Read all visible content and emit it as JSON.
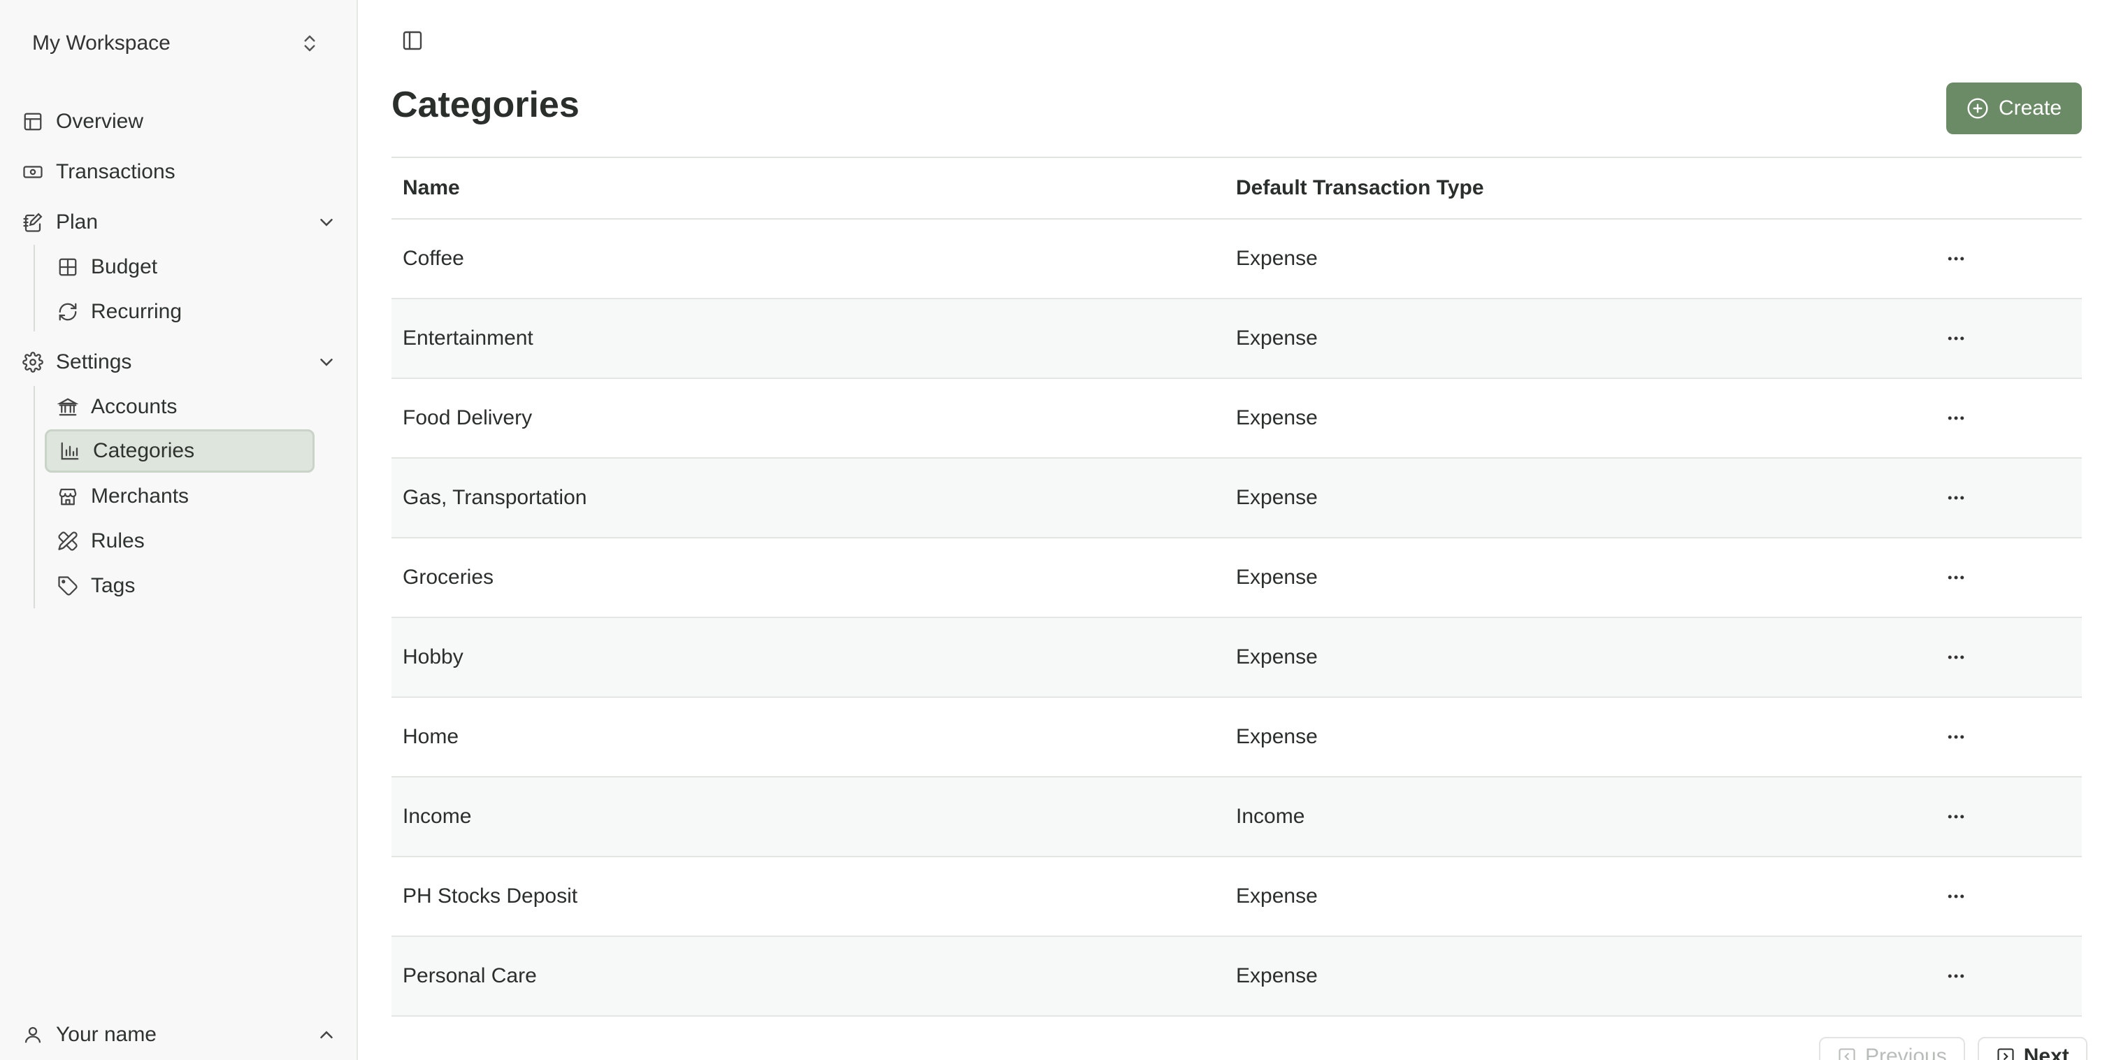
{
  "sidebar": {
    "workspace": "My Workspace",
    "items": [
      {
        "label": "Overview",
        "icon": "layout-icon"
      },
      {
        "label": "Transactions",
        "icon": "banknote-icon"
      },
      {
        "label": "Plan",
        "icon": "notebook-pen-icon",
        "expanded": true
      },
      {
        "label": "Budget",
        "icon": "grid-icon"
      },
      {
        "label": "Recurring",
        "icon": "refresh-icon"
      },
      {
        "label": "Settings",
        "icon": "gear-icon",
        "expanded": true
      },
      {
        "label": "Accounts",
        "icon": "bank-icon"
      },
      {
        "label": "Categories",
        "icon": "bar-chart-icon",
        "active": true
      },
      {
        "label": "Merchants",
        "icon": "store-icon"
      },
      {
        "label": "Rules",
        "icon": "pencil-ruler-icon"
      },
      {
        "label": "Tags",
        "icon": "tag-icon"
      }
    ],
    "user": "Your name"
  },
  "header": {
    "title": "Categories",
    "create_label": "Create"
  },
  "table": {
    "columns": [
      "Name",
      "Default Transaction Type"
    ],
    "rows": [
      {
        "name": "Coffee",
        "type": "Expense"
      },
      {
        "name": "Entertainment",
        "type": "Expense"
      },
      {
        "name": "Food Delivery",
        "type": "Expense"
      },
      {
        "name": "Gas, Transportation",
        "type": "Expense"
      },
      {
        "name": "Groceries",
        "type": "Expense"
      },
      {
        "name": "Hobby",
        "type": "Expense"
      },
      {
        "name": "Home",
        "type": "Expense"
      },
      {
        "name": "Income",
        "type": "Income"
      },
      {
        "name": "PH Stocks Deposit",
        "type": "Expense"
      },
      {
        "name": "Personal Care",
        "type": "Expense"
      }
    ]
  },
  "pagination": {
    "previous_label": "Previous",
    "next_label": "Next"
  },
  "colors": {
    "accent": "#6b8a66",
    "active_bg": "#dde5dc"
  }
}
